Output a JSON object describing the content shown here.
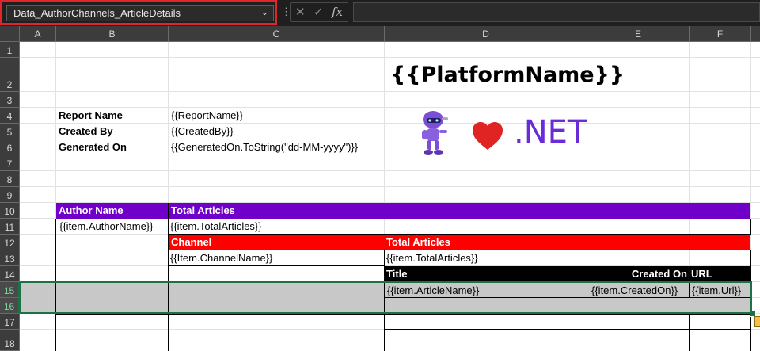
{
  "formula_bar": {
    "name_box": "Data_AuthorChannels_ArticleDetails",
    "dropdown_icon": "chevron-down-icon",
    "separator": "⋮",
    "cancel_icon": "✕",
    "enter_icon": "✓",
    "fx_label": "fx",
    "formula_value": ""
  },
  "columns": [
    "A",
    "B",
    "C",
    "D",
    "E",
    "F"
  ],
  "rows": [
    "1",
    "2",
    "3",
    "4",
    "5",
    "6",
    "7",
    "8",
    "9",
    "10",
    "11",
    "12",
    "13",
    "14",
    "15",
    "16",
    "17",
    "18"
  ],
  "header": {
    "platform_name": "{{PlatformName}}",
    "dotnet_text": ".NET",
    "bot_icon": "dotnet-bot-icon",
    "heart_icon": "heart-icon"
  },
  "meta": {
    "report_name_label": "Report Name",
    "report_name_value": "{{ReportName}}",
    "created_by_label": "Created By",
    "created_by_value": "{{CreatedBy}}",
    "generated_on_label": "Generated On",
    "generated_on_value": "{{GeneratedOn.ToString(\"dd-MM-yyyy\")}}"
  },
  "table": {
    "author_name_header": "Author Name",
    "total_articles_header": "Total Articles",
    "author_name_value": "{{item.AuthorName}}",
    "total_articles_value": "{{item.TotalArticles}}",
    "channel_header": "Channel",
    "channel_total_header": "Total Articles",
    "channel_name_value": "{{Item.ChannelName}}",
    "channel_total_value": "{{item.TotalArticles}}",
    "title_header": "Title",
    "created_on_header": "Created On",
    "url_header": "URL",
    "article_name_value": "{{item.ArticleName}}",
    "created_on_value": "{{item.CreatedOn}}",
    "url_value": "{{item.Url}}"
  },
  "colors": {
    "purple_band": "#7000c8",
    "red_band": "#ff0000",
    "black_band": "#000000",
    "dotnet_purple": "#6a2bd9",
    "selection_green": "#1e7145"
  }
}
